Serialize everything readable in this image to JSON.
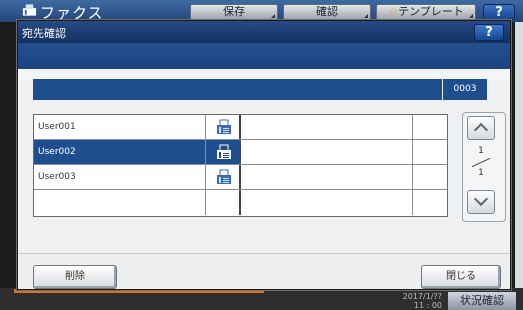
{
  "background": {
    "title": "ファクス",
    "buttons": [
      {
        "label": "保存"
      },
      {
        "label": "確認"
      },
      {
        "label": "テンプレート"
      }
    ],
    "help_label": "?",
    "clock": {
      "date": "2017/1/??",
      "time": "11 : 00"
    },
    "status_label": "状況確認"
  },
  "dialog": {
    "title": "宛先確認",
    "help_label": "?",
    "count": "0003",
    "rows": [
      {
        "name": "User001",
        "icon": "fax-icon",
        "selected": false
      },
      {
        "name": "User002",
        "icon": "fax-icon",
        "selected": true
      },
      {
        "name": "User003",
        "icon": "fax-icon",
        "selected": false
      },
      {
        "name": "",
        "icon": "",
        "selected": false
      }
    ],
    "page": {
      "current": "1",
      "total": "1"
    },
    "delete_label": "削除",
    "close_label": "閉じる"
  },
  "colors": {
    "title_blue": "#13305f",
    "selected_row": "#1f4e8f",
    "accent_orange": "#e0701d"
  }
}
